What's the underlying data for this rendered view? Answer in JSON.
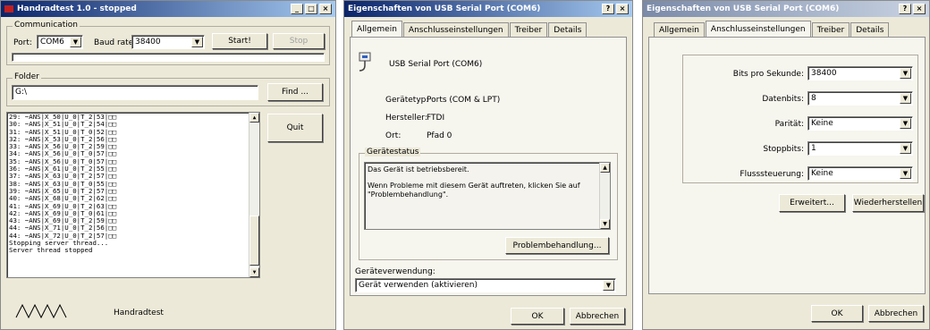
{
  "win1": {
    "title": "Handradtest 1.0 - stopped",
    "title_buttons": [
      "_",
      "□",
      "×"
    ],
    "communication": {
      "group_label": "Communication",
      "port_label": "Port:",
      "port_value": "COM6",
      "baud_label": "Baud rate:",
      "baud_value": "38400",
      "start_label": "Start!",
      "stop_label": "Stop"
    },
    "folder": {
      "group_label": "Folder",
      "path_value": "G:\\",
      "find_label": "Find ..."
    },
    "log_lines": [
      "29: ~ANS|X_50|U_0|T_2|53|□□",
      "30: ~ANS|X_51|U_0|T_2|54|□□",
      "31: ~ANS|X_51|U_0|T_0|52|□□",
      "32: ~ANS|X_53|U_0|T_2|56|□□",
      "33: ~ANS|X_56|U_0|T_2|59|□□",
      "34: ~ANS|X_56|U_0|T_0|57|□□",
      "35: ~ANS|X_56|U_0|T_0|57|□□",
      "36: ~ANS|X_61|U_0|T_2|55|□□",
      "37: ~ANS|X_63|U_0|T_2|57|□□",
      "38: ~ANS|X_63|U_0|T_0|55|□□",
      "39: ~ANS|X_65|U_0|T_2|57|□□",
      "40: ~ANS|X_68|U_0|T_2|62|□□",
      "41: ~ANS|X_69|U_0|T_2|63|□□",
      "42: ~ANS|X_69|U_0|T_0|61|□□",
      "43: ~ANS|X_69|U_0|T_2|59|□□",
      "44: ~ANS|X_71|U_0|T_2|56|□□",
      "44: ~ANS|X_72|U_0|T_2|57|□□",
      "Stopping server thread...",
      "Server thread stopped"
    ],
    "quit_label": "Quit",
    "footer_label": "Handradtest"
  },
  "win2": {
    "title": "Eigenschaften von USB Serial Port (COM6)",
    "title_buttons": [
      "?",
      "×"
    ],
    "tabs": [
      "Allgemein",
      "Anschlusseinstellungen",
      "Treiber",
      "Details"
    ],
    "device_name": "USB Serial Port (COM6)",
    "info": [
      {
        "label": "Gerätetyp:",
        "value": "Ports (COM & LPT)"
      },
      {
        "label": "Hersteller:",
        "value": "FTDI"
      },
      {
        "label": "Ort:",
        "value": "Pfad 0"
      }
    ],
    "status_group_label": "Gerätestatus",
    "status_line1": "Das Gerät ist betriebsbereit.",
    "status_line2": "Wenn Probleme mit diesem Gerät auftreten, klicken Sie auf \"Problembehandlung\".",
    "troubleshoot_label": "Problembehandlung...",
    "usage_label": "Geräteverwendung:",
    "usage_value": "Gerät verwenden (aktivieren)",
    "ok_label": "OK",
    "cancel_label": "Abbrechen"
  },
  "win3": {
    "title": "Eigenschaften von USB Serial Port (COM6)",
    "title_buttons": [
      "?",
      "×"
    ],
    "tabs": [
      "Allgemein",
      "Anschlusseinstellungen",
      "Treiber",
      "Details"
    ],
    "settings": [
      {
        "label": "Bits pro Sekunde:",
        "value": "38400"
      },
      {
        "label": "Datenbits:",
        "value": "8"
      },
      {
        "label": "Parität:",
        "value": "Keine"
      },
      {
        "label": "Stoppbits:",
        "value": "1"
      },
      {
        "label": "Flusssteuerung:",
        "value": "Keine"
      }
    ],
    "advanced_label": "Erweitert...",
    "restore_label": "Wiederherstellen",
    "ok_label": "OK",
    "cancel_label": "Abbrechen"
  }
}
